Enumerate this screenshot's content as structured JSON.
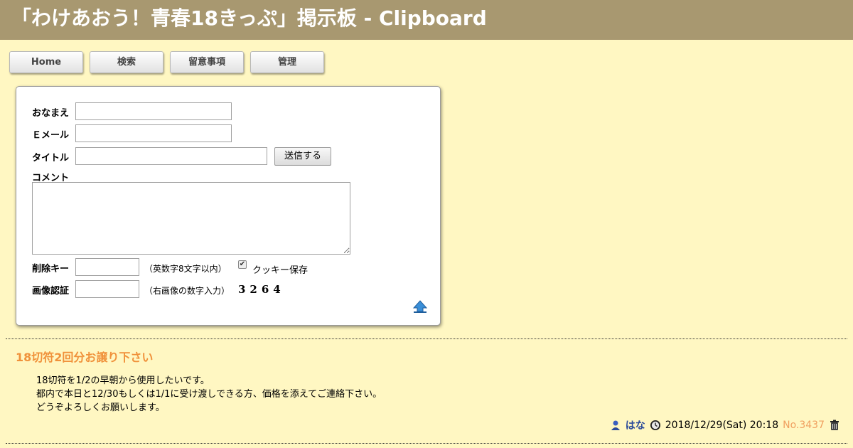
{
  "header": {
    "title": "「わけあおう！青春18きっぷ」掲示板 - Clipboard"
  },
  "nav": [
    {
      "label": "Home"
    },
    {
      "label": "検索"
    },
    {
      "label": "留意事項"
    },
    {
      "label": "管理"
    }
  ],
  "form": {
    "name_label": "おなまえ",
    "email_label": "Ｅメール",
    "title_label": "タイトル",
    "comment_label": "コメント",
    "delkey_label": "削除キー",
    "captcha_label": "画像認証",
    "name_value": "",
    "email_value": "",
    "title_value": "",
    "comment_value": "",
    "delkey_value": "",
    "captcha_value": "",
    "submit_label": "送信する",
    "delkey_note": "（英数字8文字以内）",
    "cookie_label": "クッキー保存",
    "cookie_checked": true,
    "captcha_note": "（右画像の数字入力）",
    "captcha_image_text": "3264"
  },
  "post": {
    "title": "18切符2回分お譲り下さい",
    "body": [
      "18切符を1/2の早朝から使用したいです。",
      "都内で本日と12/30もしくは1/1に受け渡しできる方、価格を添えてご連絡下さい。",
      "どうぞよろしくお願いします。"
    ],
    "author": "はな",
    "datetime": "2018/12/29(Sat) 20:18",
    "number": "No.3437"
  },
  "colors": {
    "header_bg": "#a89870",
    "page_bg": "#fff7c2",
    "post_title": "#f0913a",
    "author": "#2a4a9a",
    "post_number": "#f0a060"
  },
  "icons": [
    "user-icon",
    "clock-icon",
    "trash-icon",
    "page-top-arrow-icon"
  ]
}
